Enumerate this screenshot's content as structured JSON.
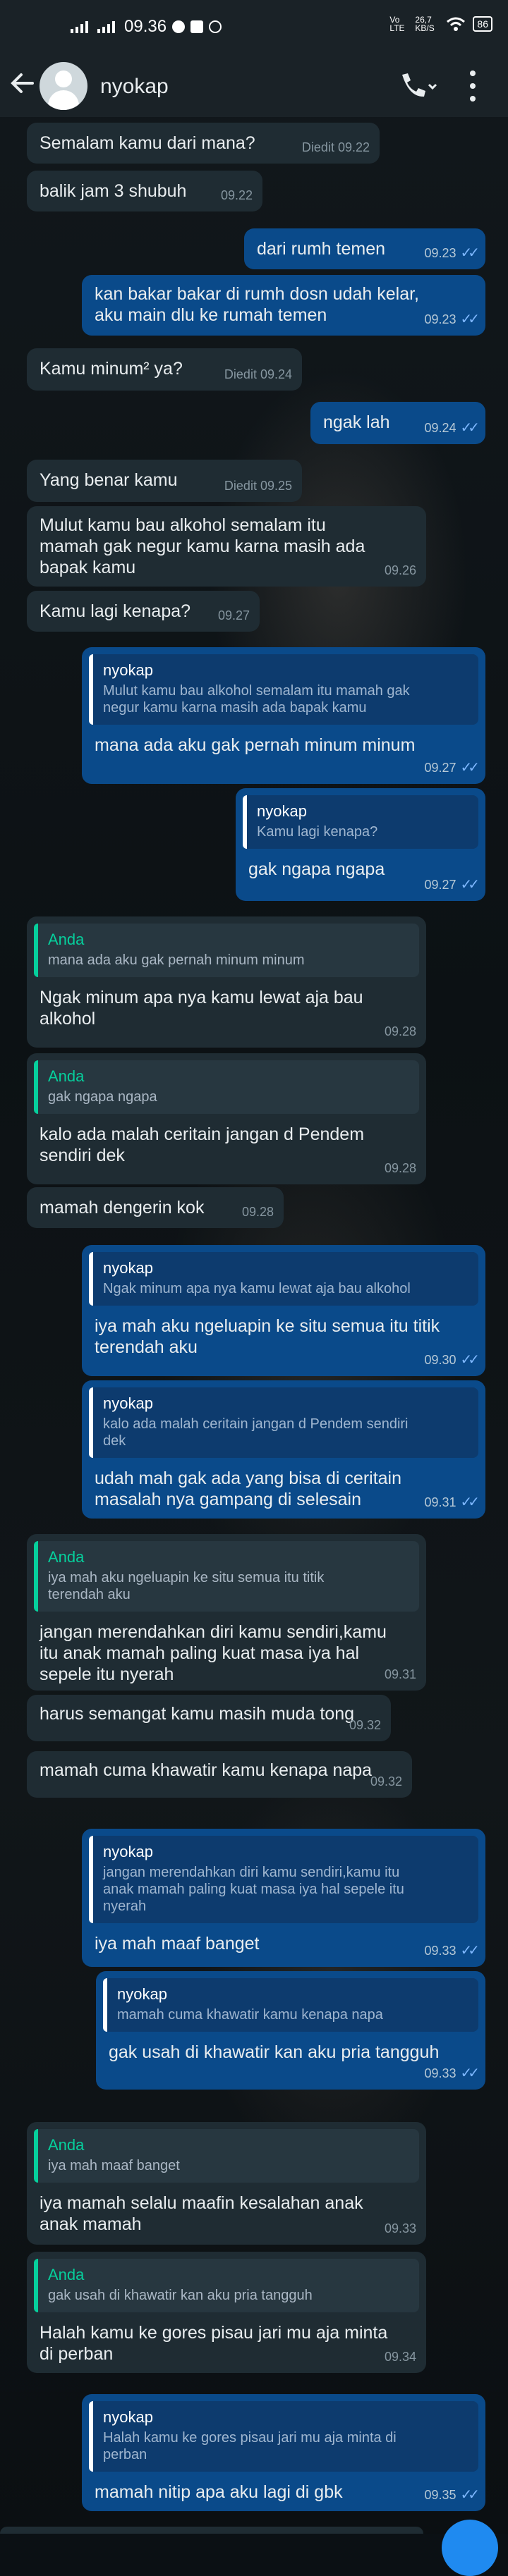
{
  "status_bar": {
    "time": "09.36",
    "network": "Vo LTE",
    "speed": "26,7 KB/S",
    "battery": "86"
  },
  "header": {
    "contact_name": "nyokap"
  },
  "icons": {
    "back": "back-arrow-icon",
    "call": "phone-call-icon",
    "menu": "more-vert-icon"
  },
  "colors": {
    "incoming": "#1f2c33",
    "outgoing": "#0a4a8a",
    "quote_in_accent": "#06cf9c",
    "tick_read": "#7fb8ff"
  },
  "messages": [
    {
      "text": "Semalam kamu dari mana?",
      "time": "Diedit 09.22"
    },
    {
      "text": "balik jam 3 shubuh",
      "time": "09.22"
    },
    {
      "text": "dari rumh temen",
      "time": "09.23"
    },
    {
      "text": "kan bakar bakar di rumh dosn udah kelar,\naku main dlu ke rumah temen",
      "time": "09.23"
    },
    {
      "text": "Kamu minum² ya?",
      "time": "Diedit 09.24"
    },
    {
      "text": "ngak lah",
      "time": "09.24"
    },
    {
      "text": "Yang benar kamu",
      "time": "Diedit 09.25"
    },
    {
      "text": "Mulut kamu bau alkohol semalam itu\nmamah gak negur kamu karna masih ada\nbapak kamu",
      "time": "09.26"
    },
    {
      "text": "Kamu lagi kenapa?",
      "time": "09.27"
    },
    {
      "quote_name": "nyokap",
      "quote_text": "Mulut kamu bau alkohol semalam itu mamah gak\nnegur kamu karna masih ada bapak kamu",
      "text": "mana ada aku gak pernah minum minum",
      "time": "09.27"
    },
    {
      "quote_name": "nyokap",
      "quote_text": "Kamu lagi kenapa?",
      "text": "gak ngapa ngapa",
      "time": "09.27"
    },
    {
      "quote_name": "Anda",
      "quote_text": "mana ada aku gak pernah minum minum",
      "text": "Ngak minum apa nya kamu lewat aja bau\nalkohol",
      "time": "09.28"
    },
    {
      "quote_name": "Anda",
      "quote_text": "gak ngapa ngapa",
      "text": "kalo ada malah ceritain jangan d Pendem\nsendiri dek",
      "time": "09.28"
    },
    {
      "text": "mamah dengerin kok",
      "time": "09.28"
    },
    {
      "quote_name": "nyokap",
      "quote_text": "Ngak minum apa nya kamu lewat aja bau alkohol",
      "text": "iya mah aku ngeluapin ke situ semua itu titik\nterendah aku",
      "time": "09.30"
    },
    {
      "quote_name": "nyokap",
      "quote_text": "kalo ada malah ceritain jangan d Pendem sendiri\ndek",
      "text": "udah mah gak ada yang bisa di ceritain\nmasalah nya gampang di selesain",
      "time": "09.31"
    },
    {
      "quote_name": "Anda",
      "quote_text": "iya mah aku ngeluapin ke situ semua itu titik\nterendah aku",
      "text": "jangan merendahkan diri kamu sendiri,kamu\nitu anak mamah paling kuat masa iya hal\nsepele itu nyerah",
      "time": "09.31"
    },
    {
      "text": "harus semangat kamu masih muda tong",
      "time": "09.32"
    },
    {
      "text": "mamah cuma khawatir kamu kenapa napa",
      "time": "09.32"
    },
    {
      "quote_name": "nyokap",
      "quote_text": "jangan merendahkan diri kamu sendiri,kamu itu\nanak mamah paling kuat masa iya hal sepele itu\nnyerah",
      "text": "iya mah maaf banget",
      "time": "09.33"
    },
    {
      "quote_name": "nyokap",
      "quote_text": "mamah cuma khawatir kamu kenapa napa",
      "text": "gak usah di khawatir kan aku pria tangguh",
      "time": "09.33"
    },
    {
      "quote_name": "Anda",
      "quote_text": "iya mah maaf banget",
      "text": "iya mamah selalu maafin kesalahan anak\nanak mamah",
      "time": "09.33"
    },
    {
      "quote_name": "Anda",
      "quote_text": "gak usah di khawatir kan aku pria tangguh",
      "text": "Halah kamu ke gores pisau jari mu aja minta\ndi perban",
      "time": "09.34"
    },
    {
      "quote_name": "nyokap",
      "quote_text": "Halah kamu ke gores pisau jari mu aja minta di\nperban",
      "text": "mamah nitip apa aku lagi di gbk",
      "time": "09.35"
    }
  ]
}
